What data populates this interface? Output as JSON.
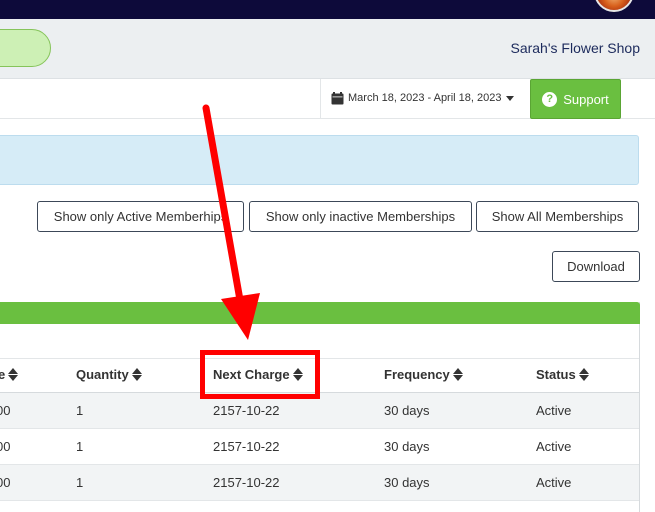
{
  "header": {
    "shop_name": "Sarah's Flower Shop"
  },
  "toolbar": {
    "date_range": "March 18, 2023 - April 18, 2023",
    "support_label": "Support",
    "support_color": "#6abf40"
  },
  "filters": {
    "active_label": "Show only Active Memberhips",
    "inactive_label": "Show only inactive Memberships",
    "all_label": "Show All Memberships"
  },
  "download_label": "Download",
  "table": {
    "columns": [
      {
        "label": "e"
      },
      {
        "label": "Quantity"
      },
      {
        "label": "Next Charge"
      },
      {
        "label": "Frequency"
      },
      {
        "label": "Status"
      }
    ],
    "rows": [
      {
        "price": "00",
        "quantity": "1",
        "next_charge": "2157-10-22",
        "frequency": "30 days",
        "status": "Active"
      },
      {
        "price": "00",
        "quantity": "1",
        "next_charge": "2157-10-22",
        "frequency": "30 days",
        "status": "Active"
      },
      {
        "price": "00",
        "quantity": "1",
        "next_charge": "2157-10-22",
        "frequency": "30 days",
        "status": "Active"
      }
    ]
  },
  "annotation": {
    "color": "#ff0000"
  }
}
